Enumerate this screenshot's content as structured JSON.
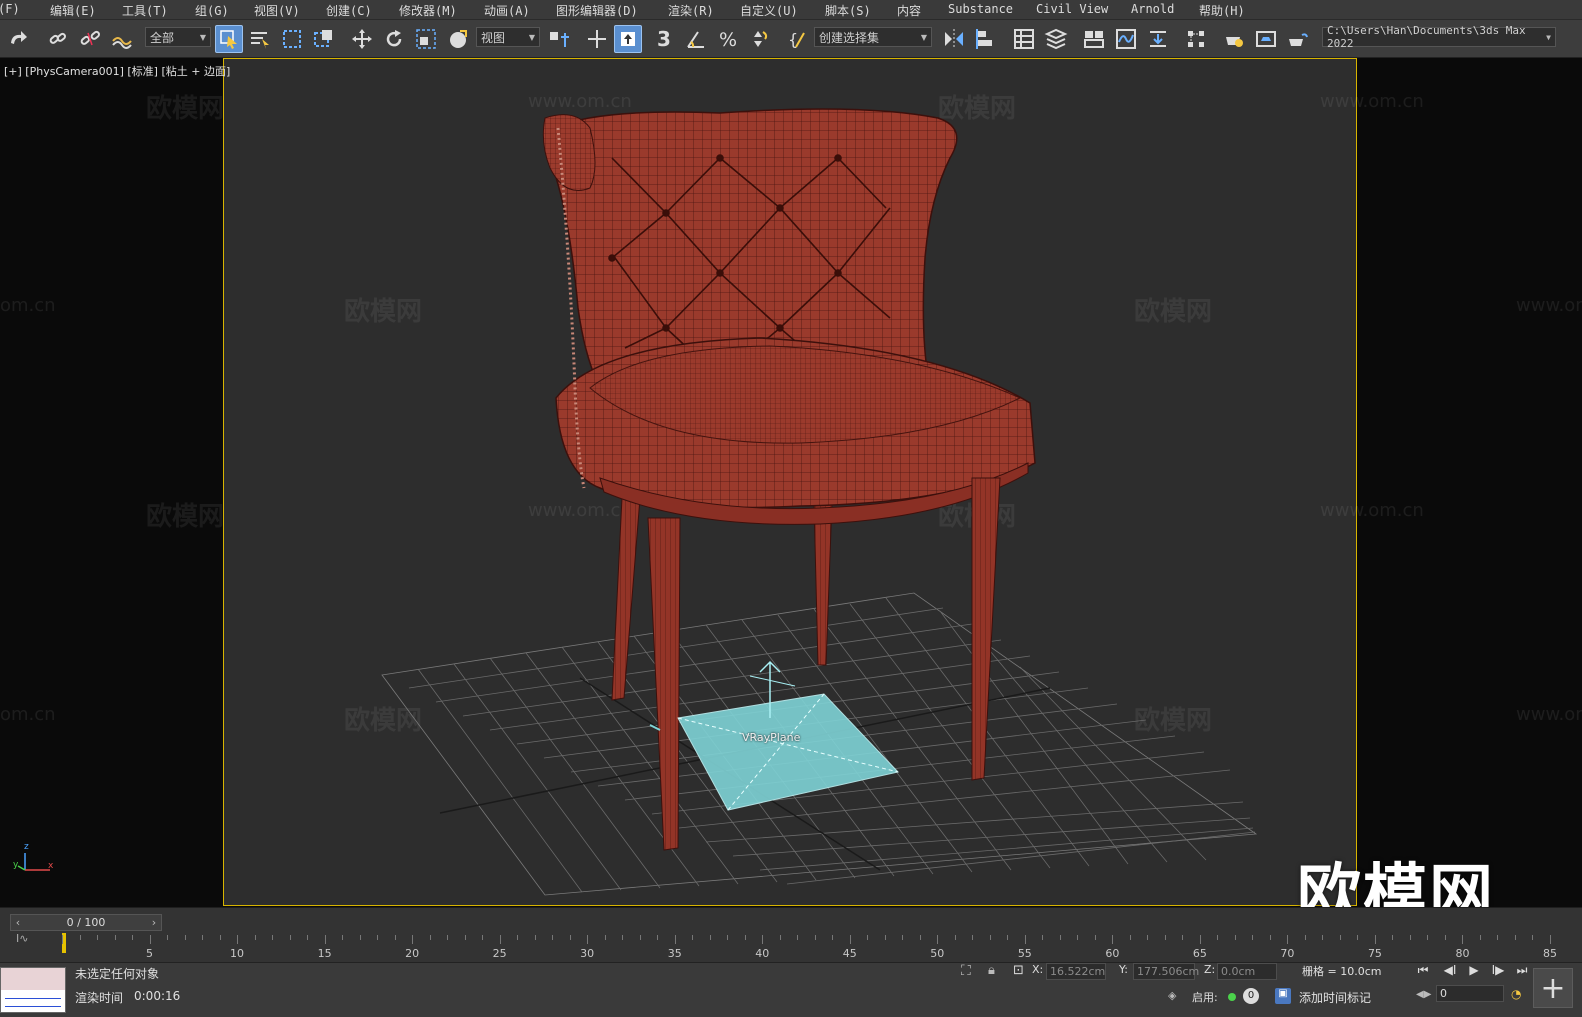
{
  "menu": {
    "items": [
      "(F)",
      "编辑(E)",
      "工具(T)",
      "组(G)",
      "视图(V)",
      "创建(C)",
      "修改器(M)",
      "动画(A)",
      "图形编辑器(D)",
      "渲染(R)",
      "自定义(U)",
      "脚本(S)",
      "内容",
      "Substance",
      "Civil View",
      "Arnold",
      "帮助(H)"
    ]
  },
  "toolbar": {
    "selection_filter": "全部",
    "reference_coord": "视图",
    "named_selection": "创建选择集",
    "project_path": "C:\\Users\\Han\\Documents\\3ds Max 2022",
    "snap_value": "3"
  },
  "viewport": {
    "label": "[+] [PhysCamera001] [标准] [粘土 + 边面]",
    "object_label": "VRayPlane",
    "watermark_text": "欧模网",
    "watermark_url": "www.om.cn",
    "watermark_url_short": "om.cn",
    "logo_text": "欧模网",
    "axis_x": "x",
    "axis_y": "y",
    "axis_z": "z"
  },
  "timeline": {
    "frame_display": "0 / 100",
    "ticks": [
      0,
      5,
      10,
      15,
      20,
      25,
      30,
      35,
      40,
      45,
      50,
      55,
      60,
      65,
      70,
      75,
      80,
      85
    ]
  },
  "status": {
    "selection_message": "未选定任何对象",
    "render_time_label": "渲染时间",
    "render_time_value": "0:00:16",
    "x_label": "X:",
    "x_value": "16.522cm",
    "y_label": "Y:",
    "y_value": "177.506cm",
    "z_label": "Z:",
    "z_value": "0.0cm",
    "grid_label": "栅格 = 10.0cm",
    "enable_label": "启用:",
    "enable_count": "0",
    "add_time_tag": "添加时间标记",
    "current_frame": "0"
  },
  "colors": {
    "safe_frame": "#d7b400",
    "chair": "#9a3a2c",
    "plane": "#7fd3d6",
    "active_button": "#5a8fd0"
  }
}
